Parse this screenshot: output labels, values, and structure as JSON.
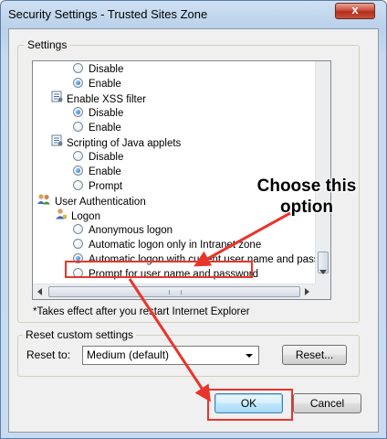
{
  "window": {
    "title": "Security Settings - Trusted Sites Zone",
    "close_glyph": "x"
  },
  "settings": {
    "group_label": "Settings",
    "items": [
      {
        "type": "radio",
        "label": "Disable",
        "checked": false
      },
      {
        "type": "radio",
        "label": "Enable",
        "checked": true
      },
      {
        "type": "header",
        "label": "Enable XSS filter",
        "icon": "settings-page-icon"
      },
      {
        "type": "radio",
        "label": "Disable",
        "checked": true
      },
      {
        "type": "radio",
        "label": "Enable",
        "checked": false
      },
      {
        "type": "header",
        "label": "Scripting of Java applets",
        "icon": "settings-page-icon"
      },
      {
        "type": "radio",
        "label": "Disable",
        "checked": false
      },
      {
        "type": "radio",
        "label": "Enable",
        "checked": true
      },
      {
        "type": "radio",
        "label": "Prompt",
        "checked": false
      },
      {
        "type": "header",
        "label": "User Authentication",
        "icon": "users-icon"
      },
      {
        "type": "header",
        "label": "Logon",
        "icon": "user-icon"
      },
      {
        "type": "radio",
        "label": "Anonymous logon",
        "checked": false
      },
      {
        "type": "radio",
        "label": "Automatic logon only in Intranet zone",
        "checked": false
      },
      {
        "type": "radio",
        "label": "Automatic logon with current user name and password",
        "checked": true
      },
      {
        "type": "radio",
        "label": "Prompt for user name and password",
        "checked": false
      }
    ],
    "note": "*Takes effect after you restart Internet Explorer"
  },
  "reset": {
    "group_label": "Reset custom settings",
    "reset_to_label": "Reset to:",
    "selected_level": "Medium (default)",
    "reset_button": "Reset..."
  },
  "footer": {
    "ok_label": "OK",
    "cancel_label": "Cancel"
  },
  "annotation": {
    "callout_line1": "Choose this",
    "callout_line2": "option",
    "color": "#e8352c"
  }
}
